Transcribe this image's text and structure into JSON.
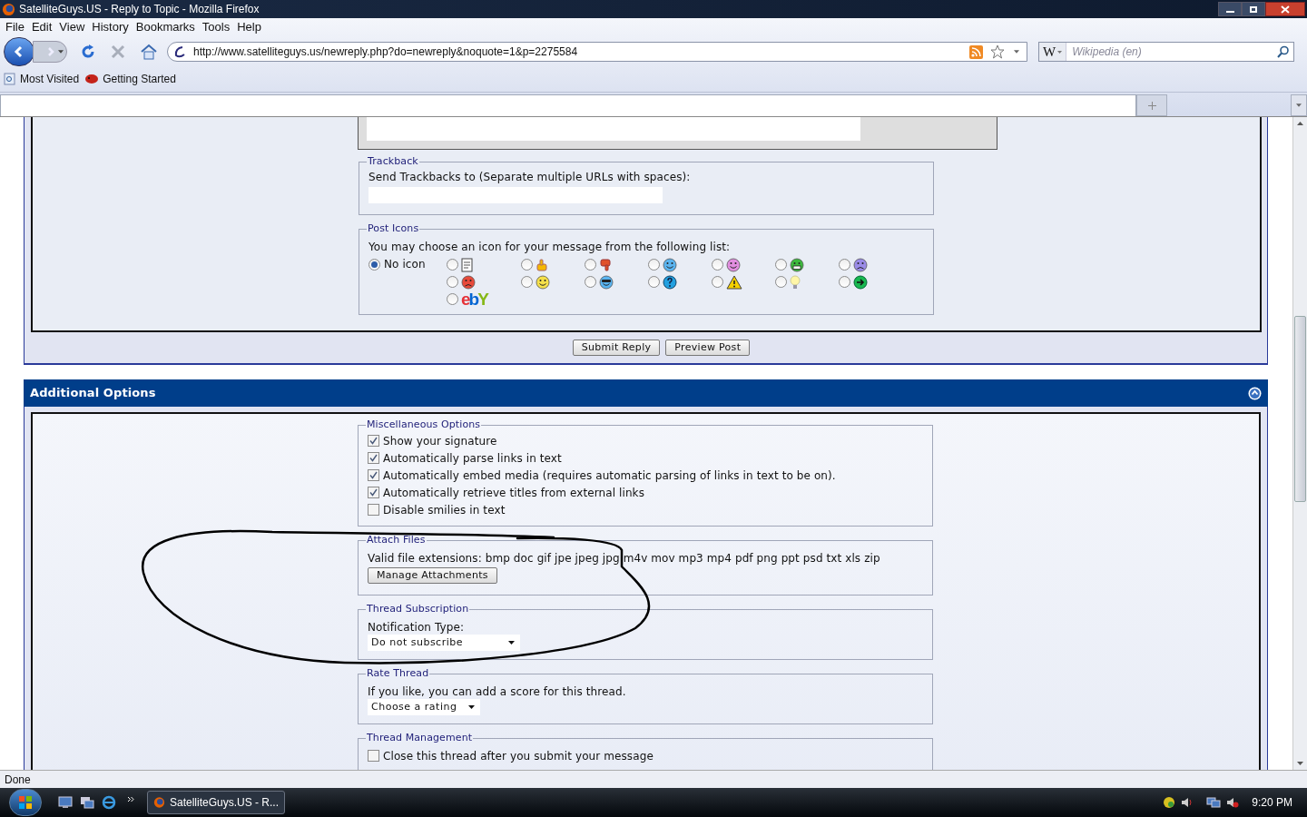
{
  "window": {
    "title": "SatelliteGuys.US - Reply to Topic - Mozilla Firefox"
  },
  "menu": [
    "File",
    "Edit",
    "View",
    "History",
    "Bookmarks",
    "Tools",
    "Help"
  ],
  "address": {
    "url": "http://www.satelliteguys.us/newreply.php?do=newreply&noquote=1&p=2275584"
  },
  "search": {
    "engine": "W",
    "placeholder": "Wikipedia (en)"
  },
  "bookmarks": [
    "Most Visited",
    "Getting Started"
  ],
  "trackback": {
    "legend": "Trackback",
    "label": "Send Trackbacks to (Separate multiple URLs with spaces):"
  },
  "post_icons": {
    "legend": "Post Icons",
    "prompt": "You may choose an icon for your message from the following list:",
    "none_label": "No icon",
    "none_selected": true,
    "options": [
      {
        "kind": "document",
        "selected": false
      },
      {
        "kind": "thumbs-up",
        "selected": false
      },
      {
        "kind": "thumbs-down",
        "selected": false
      },
      {
        "kind": "wink",
        "selected": false
      },
      {
        "kind": "pink-smile",
        "selected": false
      },
      {
        "kind": "grin",
        "selected": false
      },
      {
        "kind": "sad",
        "selected": false
      },
      {
        "kind": "angry",
        "selected": false
      },
      {
        "kind": "smile",
        "selected": false
      },
      {
        "kind": "cool",
        "selected": false
      },
      {
        "kind": "question",
        "selected": false
      },
      {
        "kind": "warning",
        "selected": false
      },
      {
        "kind": "lightbulb",
        "selected": false
      },
      {
        "kind": "arrow",
        "selected": false
      },
      {
        "kind": "logo",
        "selected": false,
        "label": "ebY"
      }
    ]
  },
  "buttons": [
    "Submit Reply",
    "Preview Post"
  ],
  "additional_options": {
    "title": "Additional Options",
    "misc": {
      "legend": "Miscellaneous Options",
      "options": [
        {
          "label": "Show your signature",
          "checked": true
        },
        {
          "label": "Automatically parse links in text",
          "checked": true
        },
        {
          "label": "Automatically embed media (requires automatic parsing of links in text to be on).",
          "checked": true
        },
        {
          "label": "Automatically retrieve titles from external links",
          "checked": true
        },
        {
          "label": "Disable smilies in text",
          "checked": false
        }
      ]
    },
    "attach": {
      "legend": "Attach Files",
      "text": "Valid file extensions: bmp doc gif jpe jpeg jpg m4v mov mp3 mp4 pdf png ppt psd txt xls zip",
      "button": "Manage Attachments"
    },
    "subscription": {
      "legend": "Thread Subscription",
      "label": "Notification Type:",
      "value": "Do not subscribe"
    },
    "rate": {
      "legend": "Rate Thread",
      "text": "If you like, you can add a score for this thread.",
      "value": "Choose a rating"
    },
    "management": {
      "legend": "Thread Management",
      "options": [
        {
          "label": "Close this thread after you submit your message",
          "checked": false
        }
      ]
    }
  },
  "status_bar": {
    "text": "Done"
  },
  "taskbar": {
    "task": "SatelliteGuys.US - R...",
    "clock": "9:20 PM"
  }
}
